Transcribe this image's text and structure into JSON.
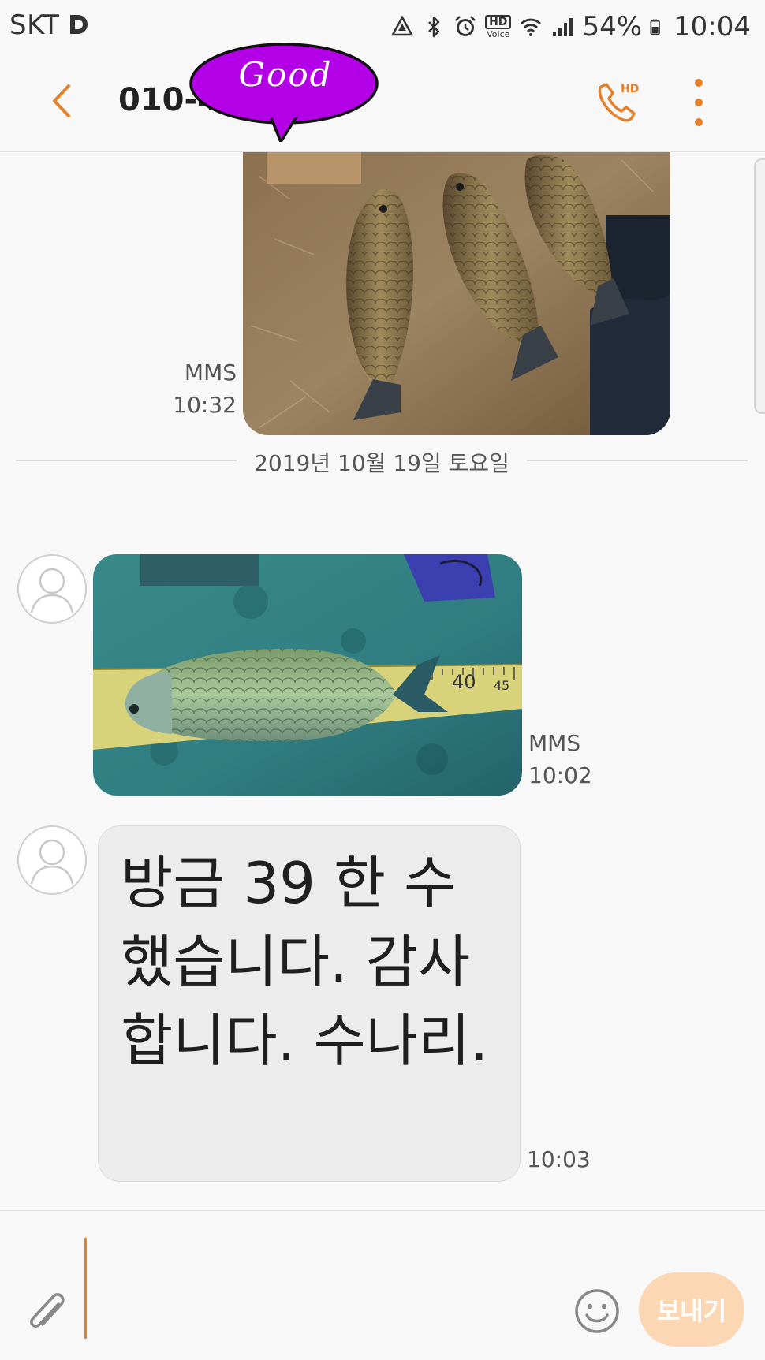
{
  "status_bar": {
    "carrier": "SKT",
    "hd_label": "HD",
    "voice_label": "Voice",
    "battery": "54%",
    "time": "10:04",
    "icons": [
      "d-app-icon",
      "data-saver-icon",
      "bluetooth-icon",
      "alarm-icon",
      "hd-voice-icon",
      "wifi-icon",
      "signal-icon",
      "battery-icon"
    ]
  },
  "header": {
    "contact_name": "010-4",
    "sticker_text": "Good",
    "call_badge": "HD",
    "icons": [
      "back-arrow-icon",
      "hd-call-icon",
      "more-vert-icon"
    ],
    "accent_color": "#e5802b"
  },
  "conversation": {
    "messages": [
      {
        "type": "MMS",
        "direction": "sent",
        "time": "10:32",
        "content": "photo-three-fish"
      },
      {
        "type": "MMS",
        "direction": "received",
        "time": "10:02",
        "content": "photo-fish-on-ruler"
      },
      {
        "type": "text",
        "direction": "received",
        "time": "10:03",
        "text": "방금 39 한 수 했습니다. 감사합니다. 수나리."
      }
    ],
    "date_separator": "2019년 10월 19일 토요일",
    "ruler_marks": [
      "40",
      "45"
    ]
  },
  "input_bar": {
    "placeholder": "",
    "send_label": "보내기",
    "icons": [
      "attach-icon",
      "emoji-icon"
    ]
  }
}
